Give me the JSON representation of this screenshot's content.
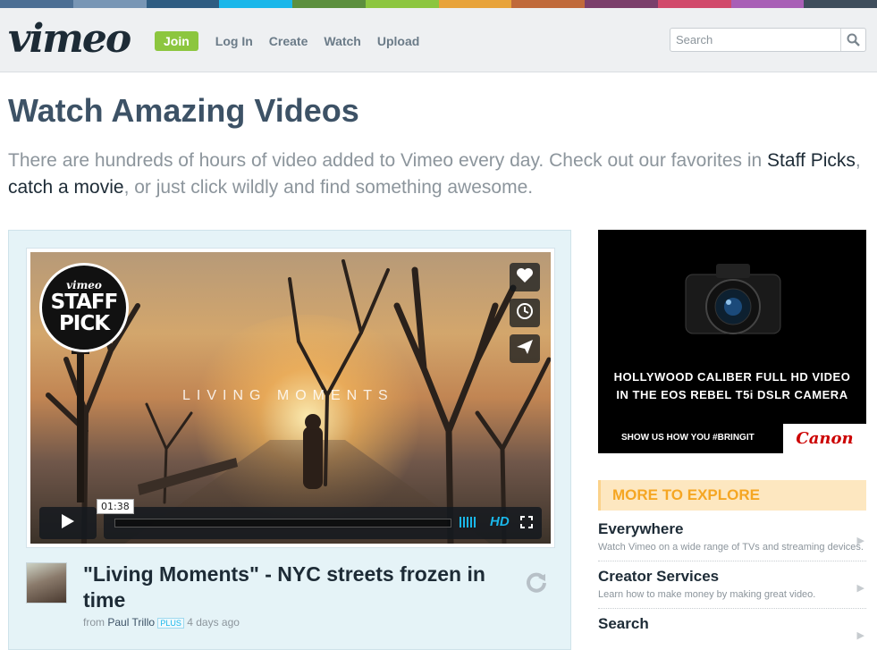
{
  "colors": {
    "stripe": [
      "#4c6f94",
      "#7896b5",
      "#2f5d82",
      "#1ab7ea",
      "#5c8f3e",
      "#8cc63f",
      "#e8a33a",
      "#c06a3b",
      "#7a3f6b",
      "#d14a6b",
      "#a85fb6",
      "#3e4d5c"
    ],
    "accent": "#1ab7ea",
    "join": "#8cc63f",
    "more_header": "#f5a623",
    "canon_red": "#cc0000"
  },
  "header": {
    "logo": "vimeo",
    "nav": {
      "join": "Join",
      "login": "Log In",
      "create": "Create",
      "watch": "Watch",
      "upload": "Upload"
    },
    "search": {
      "placeholder": "Search",
      "icon": "search-icon"
    }
  },
  "page": {
    "title": "Watch Amazing Videos",
    "intro_part1": "There are hundreds of hours of video added to Vimeo every day. Check out our favorites in ",
    "intro_link1": "Staff Picks",
    "intro_part2": ", ",
    "intro_link2": "catch a movie",
    "intro_part3": ", or just click wildly and find something awesome."
  },
  "featured": {
    "badge_top": "vimeo",
    "badge_line1": "STAFF",
    "badge_line2": "PICK",
    "video_overlay_title": "LIVING MOMENTS",
    "current_time": "01:38",
    "hd_label": "HD",
    "side_icons": [
      "heart-icon",
      "clock-icon",
      "share-icon"
    ],
    "title": "\"Living Moments\" - NYC streets frozen in time",
    "byline_from": "from ",
    "author": "Paul Trillo",
    "author_badge": "PLUS",
    "posted": "4 days ago"
  },
  "ad": {
    "line1": "HOLLYWOOD CALIBER FULL HD VIDEO",
    "line2": "IN THE EOS REBEL T5i DSLR CAMERA",
    "cta": "SHOW US HOW YOU #BRINGIT",
    "brand": "Canon"
  },
  "explore": {
    "header": "MORE TO EXPLORE",
    "items": [
      {
        "name": "Everywhere",
        "desc": "Watch Vimeo on a wide range of TVs and streaming devices."
      },
      {
        "name": "Creator Services",
        "desc": "Learn how to make money by making great video."
      },
      {
        "name": "Search",
        "desc": ""
      }
    ]
  }
}
